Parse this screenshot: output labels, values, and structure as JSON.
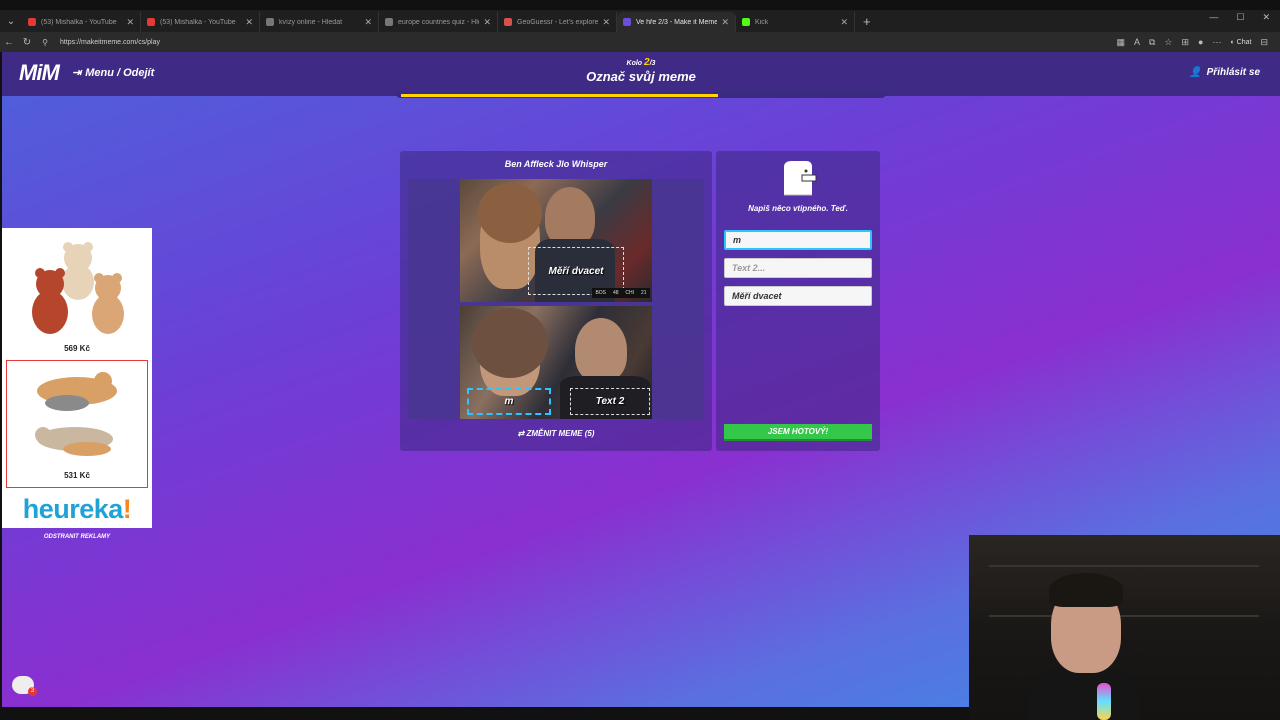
{
  "browser": {
    "tabs": [
      {
        "title": "(53) Mishalka - YouTube",
        "color": "#e53935"
      },
      {
        "title": "(53) Mishalka - YouTube",
        "color": "#e53935"
      },
      {
        "title": "kvízy online - Hledat",
        "color": "#777777"
      },
      {
        "title": "europe countries quiz - Hledat",
        "color": "#777777"
      },
      {
        "title": "GeoGuessr - Let's explore the wo",
        "color": "#d84f4f"
      },
      {
        "title": "Ve hře 2/3 - Make it Meme",
        "color": "#6b4fd8",
        "active": true
      },
      {
        "title": "Kick",
        "color": "#53fc18"
      }
    ],
    "url": "https://makeitmeme.com/cs/play",
    "chat_label": "Chat"
  },
  "header": {
    "logo": "MiM",
    "menu_label": "Menu / Odejít",
    "round_prefix": "Kolo",
    "round_current": "2",
    "round_total": "/3",
    "title": "Označ svůj meme",
    "login_label": "Přihlásit se",
    "progress": 0.66
  },
  "meme": {
    "title": "Ben Affleck Jlo Whisper",
    "captions": {
      "top_right": "Měří dvacet",
      "bottom_left": "m",
      "bottom_right": "Text 2"
    },
    "scoreboard": [
      "BOS",
      "48",
      "CHI",
      "21"
    ],
    "change_label": "ZMĚNIT MEME (5)"
  },
  "inputs": {
    "prompt": "Napiš něco vtipného. Teď.",
    "field1_value": "m",
    "field2_placeholder": "Text 2...",
    "field3_value": "Měří dvacet",
    "done_label": "JSEM HOTOVÝ!"
  },
  "ad": {
    "item1_price": "569 Kč",
    "item2_price": "531 Kč",
    "brand": "heureka",
    "brand_mark": "!",
    "remove_label": "ODSTRANIT REKLAMY"
  },
  "chat": {
    "badge": "3"
  },
  "icons": {
    "menu": "exit-icon",
    "login": "user-icon",
    "change": "refresh-icon"
  }
}
